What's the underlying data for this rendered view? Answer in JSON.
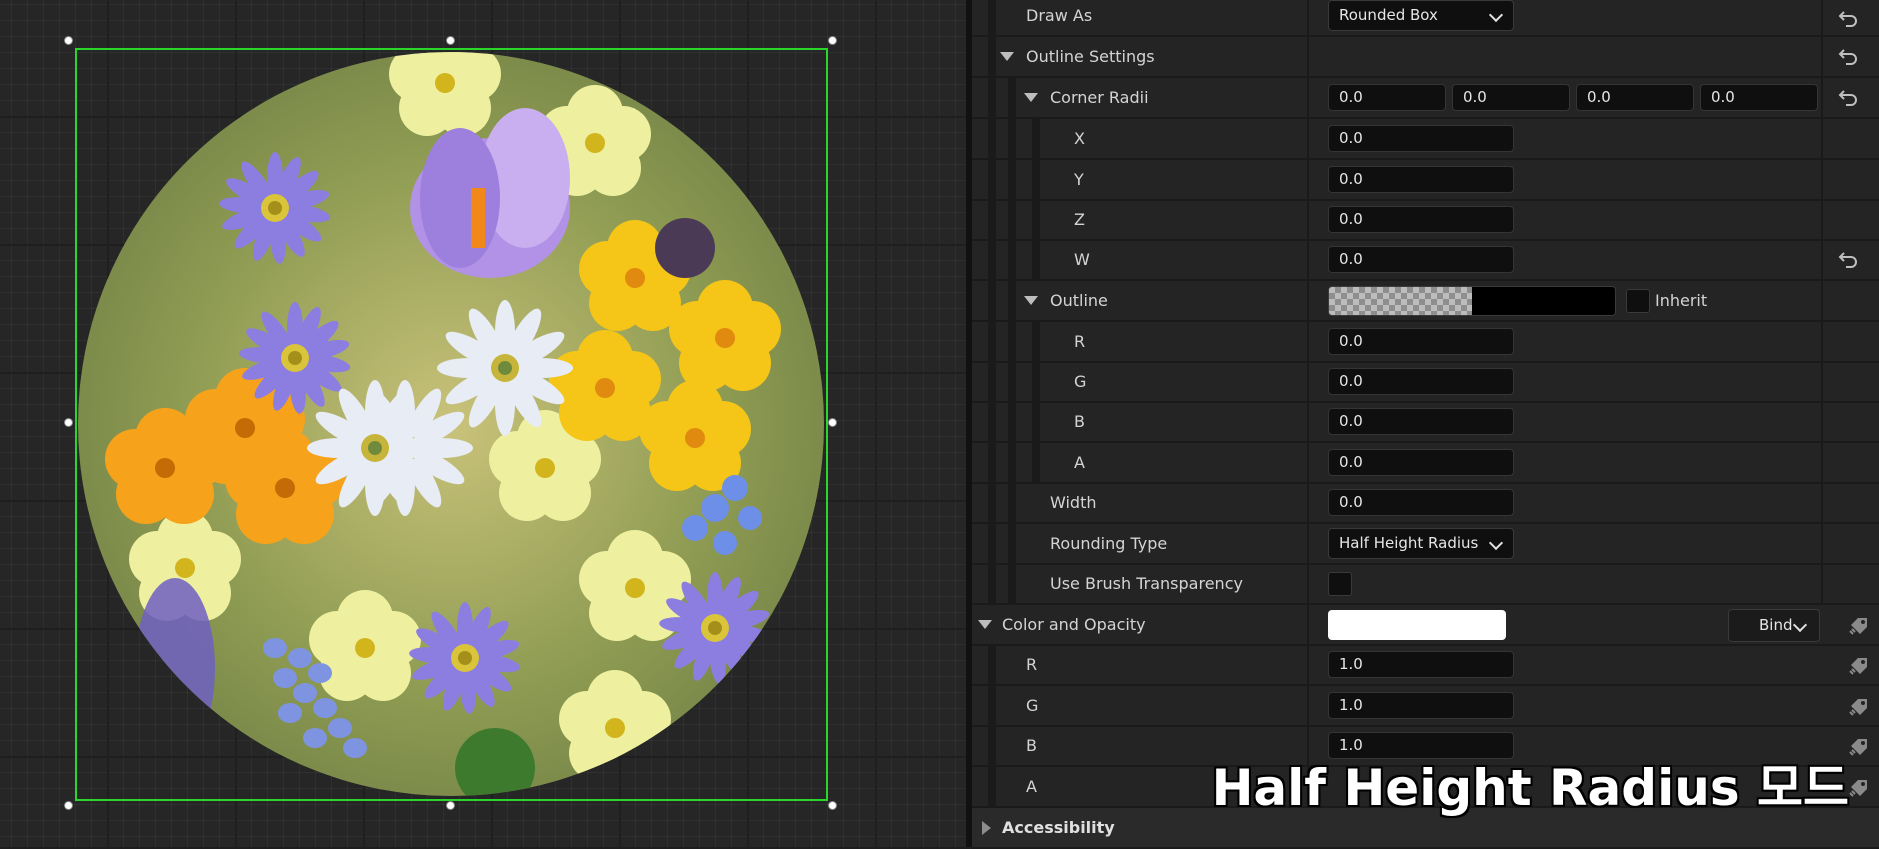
{
  "canvas": {
    "image_description_icon": "flower-image-icon"
  },
  "details": {
    "draw_as": {
      "label": "Draw As",
      "value": "Rounded Box"
    },
    "outline_settings": {
      "label": "Outline Settings"
    },
    "corner_radii": {
      "label": "Corner Radii",
      "values": [
        "0.0",
        "0.0",
        "0.0",
        "0.0"
      ],
      "x": {
        "label": "X",
        "value": "0.0"
      },
      "y": {
        "label": "Y",
        "value": "0.0"
      },
      "z": {
        "label": "Z",
        "value": "0.0"
      },
      "w": {
        "label": "W",
        "value": "0.0"
      }
    },
    "outline": {
      "label": "Outline",
      "inherit_label": "Inherit",
      "r": {
        "label": "R",
        "value": "0.0"
      },
      "g": {
        "label": "G",
        "value": "0.0"
      },
      "b": {
        "label": "B",
        "value": "0.0"
      },
      "a": {
        "label": "A",
        "value": "0.0"
      }
    },
    "width": {
      "label": "Width",
      "value": "0.0"
    },
    "rounding_type": {
      "label": "Rounding Type",
      "value": "Half Height Radius"
    },
    "use_brush_transparency": {
      "label": "Use Brush Transparency"
    },
    "color_and_opacity": {
      "label": "Color and Opacity",
      "bind_label": "Bind",
      "r": {
        "label": "R",
        "value": "1.0"
      },
      "g": {
        "label": "G",
        "value": "1.0"
      },
      "b": {
        "label": "B",
        "value": "1.0"
      },
      "a": {
        "label": "A"
      }
    },
    "accessibility": {
      "label": "Accessibility"
    }
  },
  "caption": "Half Height Radius 모드",
  "colors": {
    "selection": "#2bd62b",
    "panel_bg": "#242424",
    "field_bg": "#0f0f0f"
  }
}
